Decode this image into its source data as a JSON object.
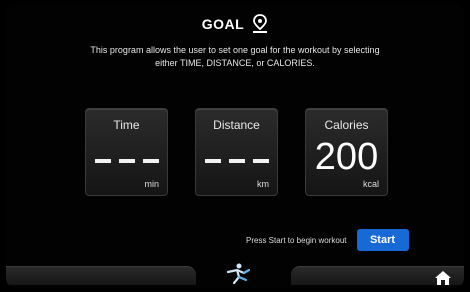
{
  "header": {
    "title": "GOAL",
    "icon": "location-pin-icon"
  },
  "description": {
    "line1": "This program allows the user to set one goal for the workout by selecting",
    "line2": "either TIME, DISTANCE, or CALORIES."
  },
  "goals": [
    {
      "label": "Time",
      "value": "- - -",
      "unit": "min"
    },
    {
      "label": "Distance",
      "value": "- - -",
      "unit": "km"
    },
    {
      "label": "Calories",
      "value": "200",
      "unit": "kcal"
    }
  ],
  "footer": {
    "hint": "Press Start to begin workout",
    "start_label": "Start",
    "center_icon": "exercise-figure-icon",
    "home_icon": "home-icon"
  },
  "colors": {
    "accent": "#1769d6",
    "background": "#000000",
    "card": "#222222"
  }
}
